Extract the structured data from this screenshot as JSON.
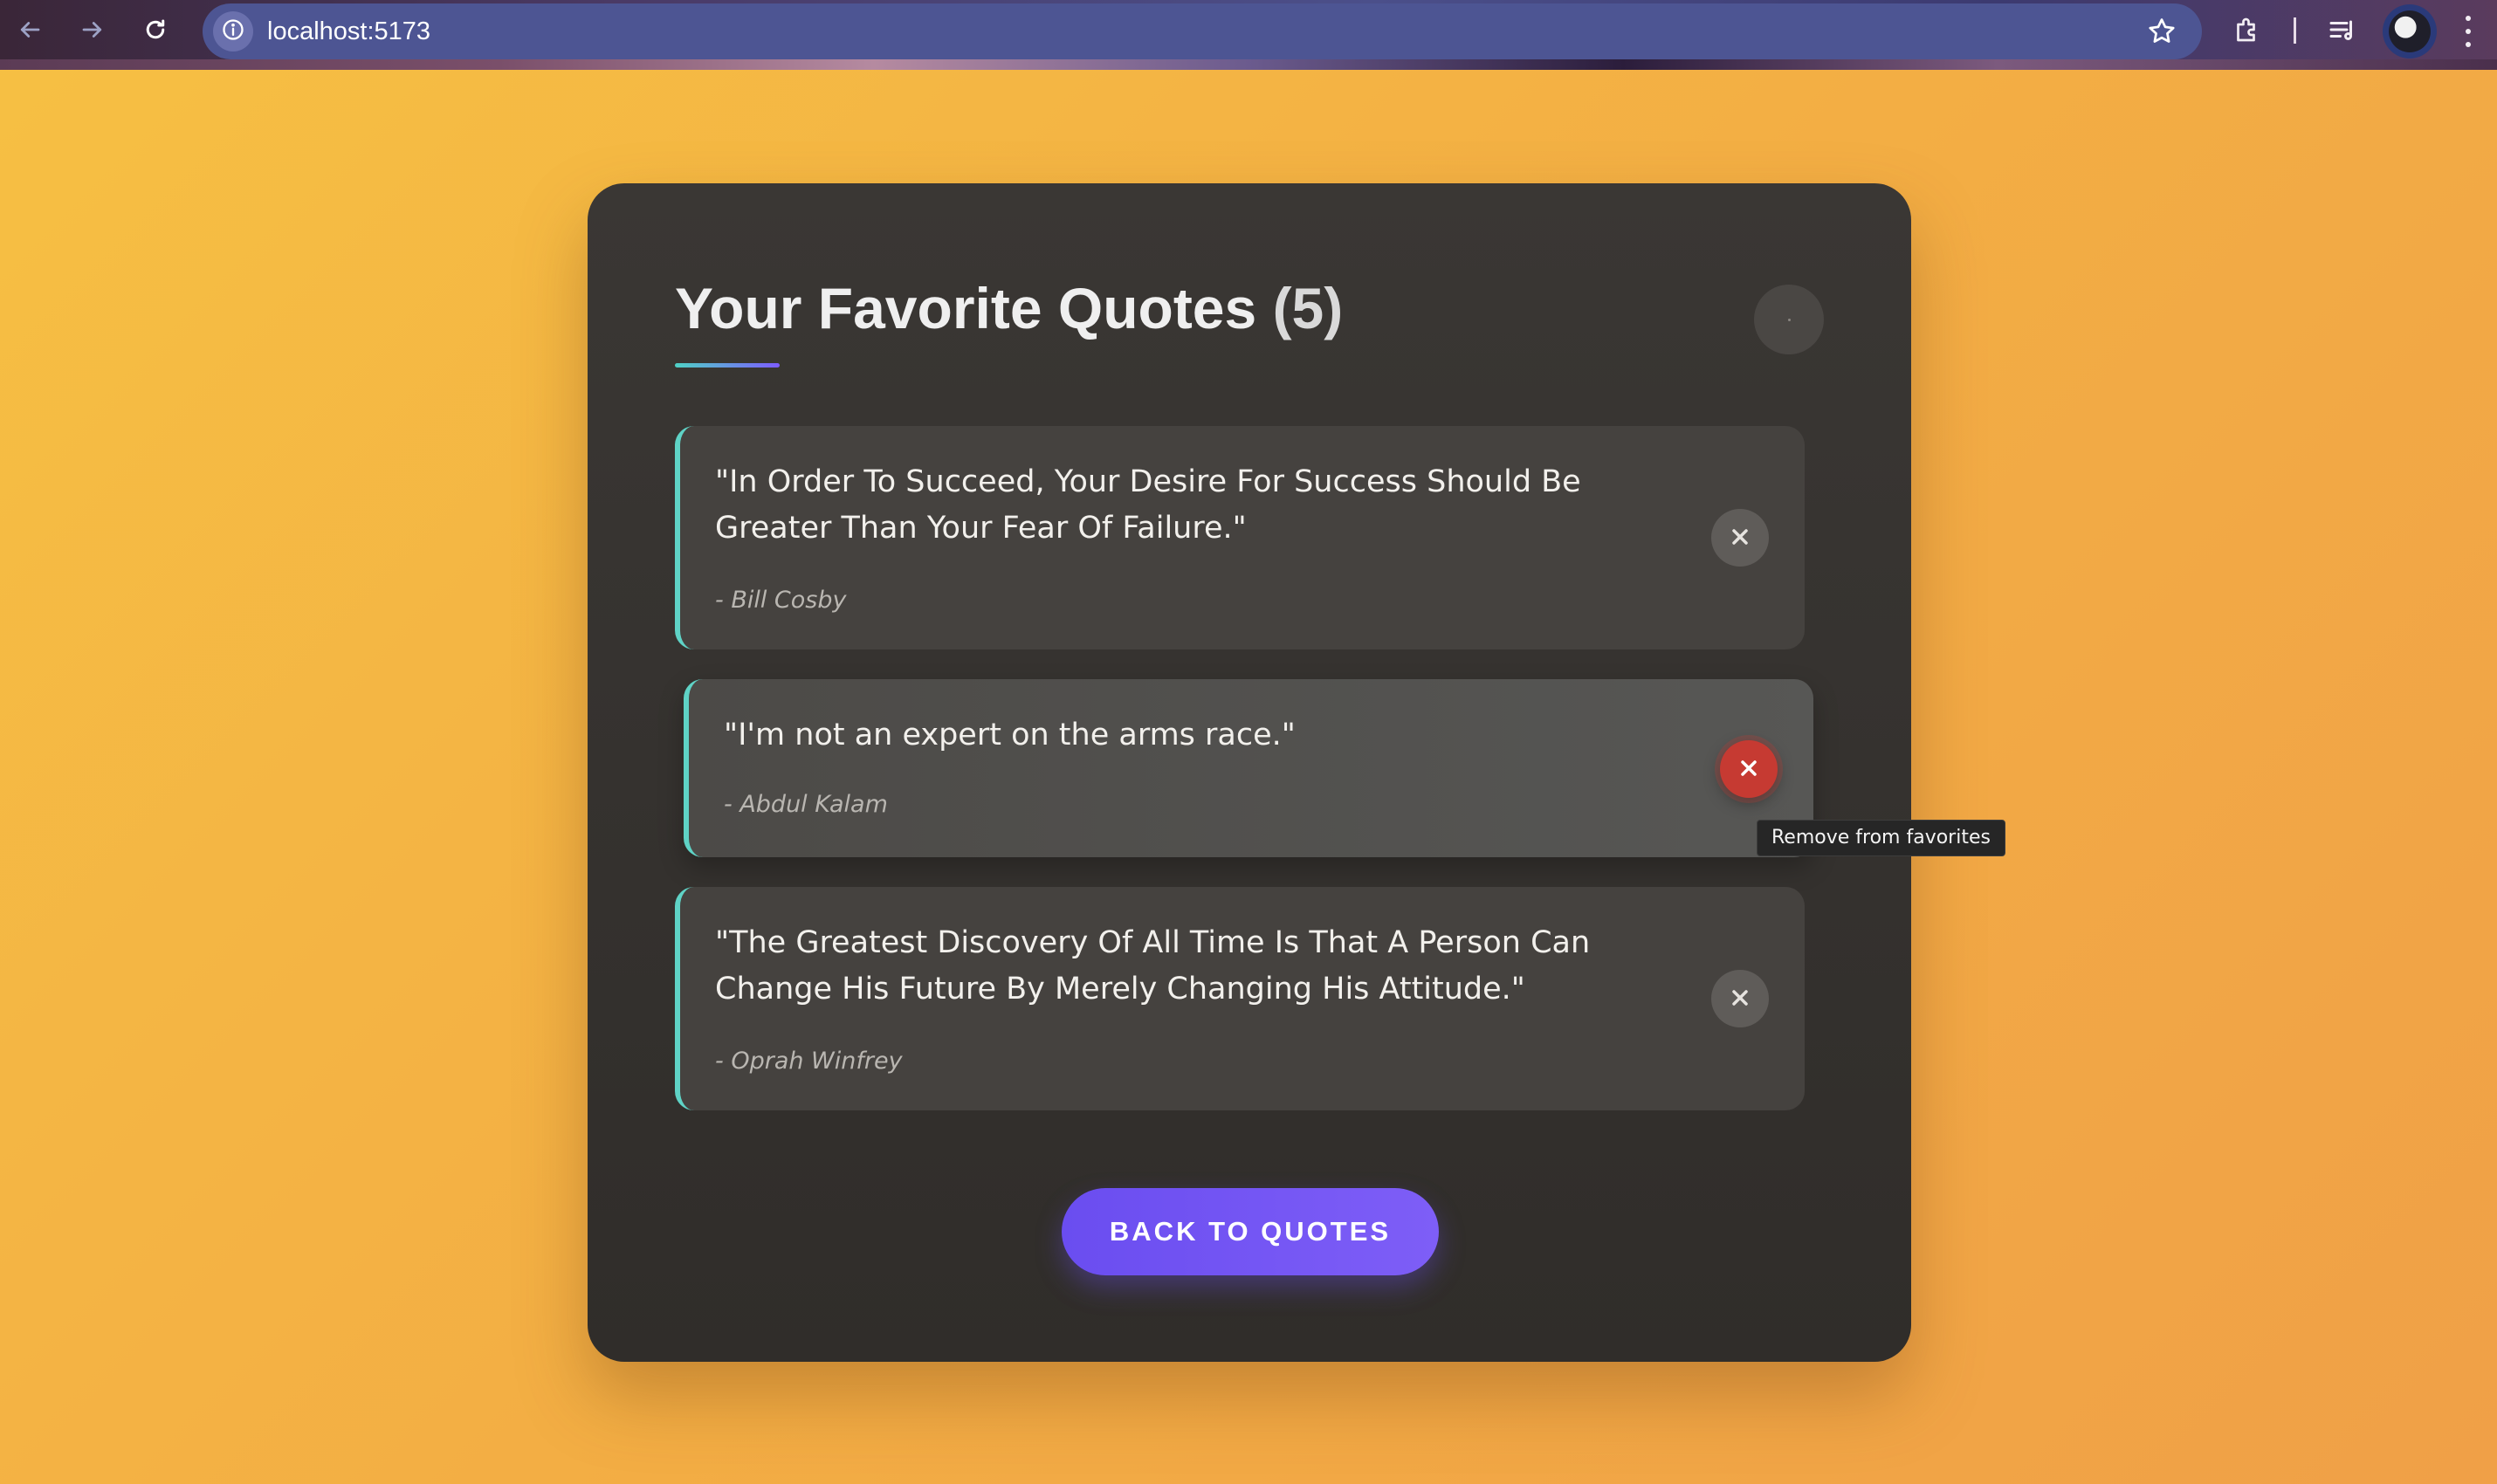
{
  "browser": {
    "url": "localhost:5173",
    "icons": {
      "back": "arrow-left-icon",
      "forward": "arrow-right-icon",
      "reload": "reload-icon",
      "site_info": "info-icon",
      "bookmark": "star-icon",
      "extensions": "puzzle-icon",
      "reading_list": "reading-list-icon",
      "profile": "avatar",
      "menu": "kebab-menu-icon"
    }
  },
  "page": {
    "title": "Your Favorite Quotes",
    "count_label": "(5)",
    "favorite_count": 5,
    "quotes": [
      {
        "text": "\"In Order To Succeed, Your Desire For Success Should Be Greater Than Your Fear Of Failure.\"",
        "author": "- Bill Cosby"
      },
      {
        "text": "\"I'm not an expert on the arms race.\"",
        "author": "- Abdul Kalam"
      },
      {
        "text": "\"The Greatest Discovery Of All Time Is That A Person Can Change His Future By Merely Changing His Attitude.\"",
        "author": "- Oprah Winfrey"
      }
    ],
    "remove_tooltip": "Remove from favorites",
    "back_button": "BACK TO QUOTES"
  },
  "colors": {
    "background": "#f3ae44",
    "card": "#34312e",
    "accent_border": "#5fd3c6",
    "button": "#7050f2",
    "remove_active": "#c63a32"
  }
}
